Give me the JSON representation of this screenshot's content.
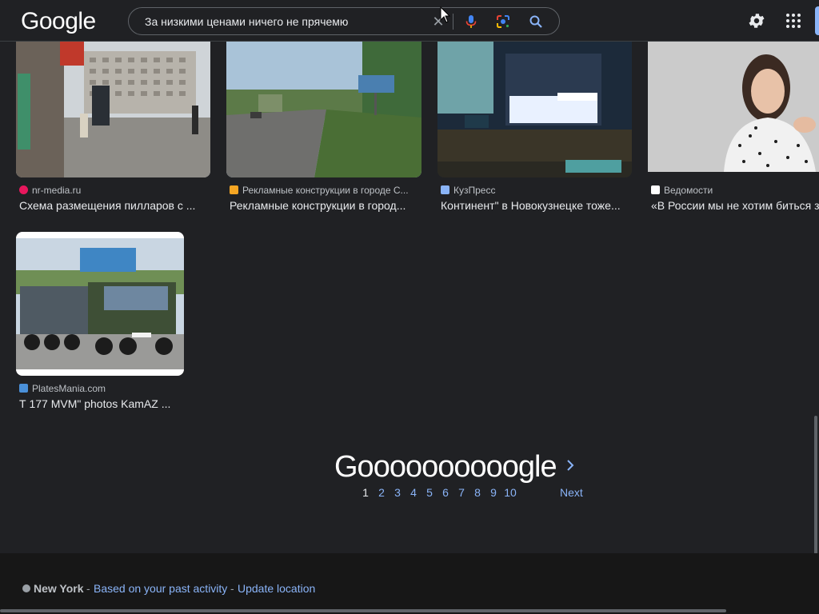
{
  "header": {
    "logo": "Google",
    "search": {
      "query": "За низкими ценами ничего не прячемю"
    },
    "icons": {
      "clear": "close-icon",
      "voice": "mic-icon",
      "lens": "lens-icon",
      "search": "search-icon",
      "settings": "gear-icon",
      "apps": "apps-grid-icon"
    }
  },
  "results": [
    {
      "source": "nr-media.ru",
      "title": "Схема размещения пилларов с ...",
      "favicon_color": "#e8175d"
    },
    {
      "source": "Рекламные конструкции в городе С...",
      "title": "Рекламные конструкции в город...",
      "favicon_color": "#f6a623"
    },
    {
      "source": "КузПресс",
      "title": "Континент\" в Новокузнецке тоже...",
      "favicon_color": "#8ab4f8"
    },
    {
      "source": "Ведомости",
      "title": "«В России мы не хотим биться за",
      "favicon_color": "#ffffff"
    },
    {
      "source": "PlatesMania.com",
      "title": "Т 177 MVM\" photos KamAZ ...",
      "favicon_color": "#4a90d9"
    }
  ],
  "pagination": {
    "logo": "Goooooooooogle",
    "pages": [
      "1",
      "2",
      "3",
      "4",
      "5",
      "6",
      "7",
      "8",
      "9",
      "10"
    ],
    "current": "1",
    "next_label": "Next"
  },
  "footer": {
    "city": "New York",
    "sep": "-",
    "basis": "Based on your past activity",
    "update": "Update location"
  },
  "colors": {
    "background": "#202124",
    "link": "#8ab4f8",
    "footer_bg": "#171717"
  }
}
